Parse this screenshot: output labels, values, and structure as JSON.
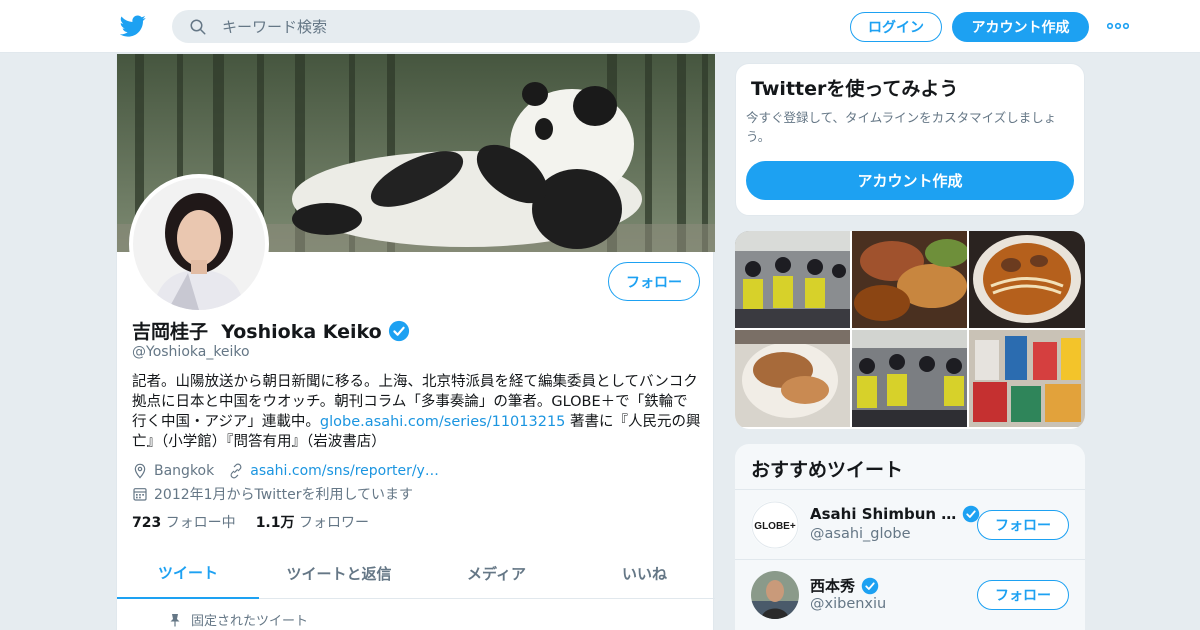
{
  "header": {
    "search_placeholder": "キーワード検索",
    "login_label": "ログイン",
    "signup_label": "アカウント作成"
  },
  "profile": {
    "name": "吉岡桂子  Yoshioka Keiko",
    "handle": "@Yoshioka_keiko",
    "follow_label": "フォロー",
    "bio_text": "記者。山陽放送から朝日新聞に移る。上海、北京特派員を経て編集委員としてバンコク拠点に日本と中国をウオッチ。朝刊コラム「多事奏論」の筆者。GLOBE＋で「鉄輪で行く中国・アジア」連載中。",
    "bio_link": "globe.asahi.com/series/11013215",
    "bio_tail": " 著書に『人民元の興亡』（小学館）『問答有用』（岩波書店）",
    "location": "Bangkok",
    "website": "asahi.com/sns/reporter/y…",
    "joined": "2012年1月からTwitterを利用しています",
    "following_count": "723",
    "following_label": "フォロー中",
    "followers_count": "1.1万",
    "followers_label": "フォロワー"
  },
  "tabs": [
    {
      "label": "ツイート"
    },
    {
      "label": "ツイートと返信"
    },
    {
      "label": "メディア"
    },
    {
      "label": "いいね"
    }
  ],
  "pinned_label": "固定されたツイート",
  "signup_card": {
    "title": "Twitterを使ってみよう",
    "text": "今すぐ登録して、タイムラインをカスタマイズしましょう。",
    "button": "アカウント作成"
  },
  "recommend": {
    "title": "おすすめツイート",
    "users": [
      {
        "name": "Asahi Shimbun …",
        "handle": "@asahi_globe",
        "follow": "フォロー",
        "avatar_text": "GLOBE+"
      },
      {
        "name": "西本秀",
        "handle": "@xibenxiu",
        "follow": "フォロー"
      }
    ]
  },
  "colors": {
    "accent": "#1da1f2",
    "verified": "#1da1f2"
  }
}
